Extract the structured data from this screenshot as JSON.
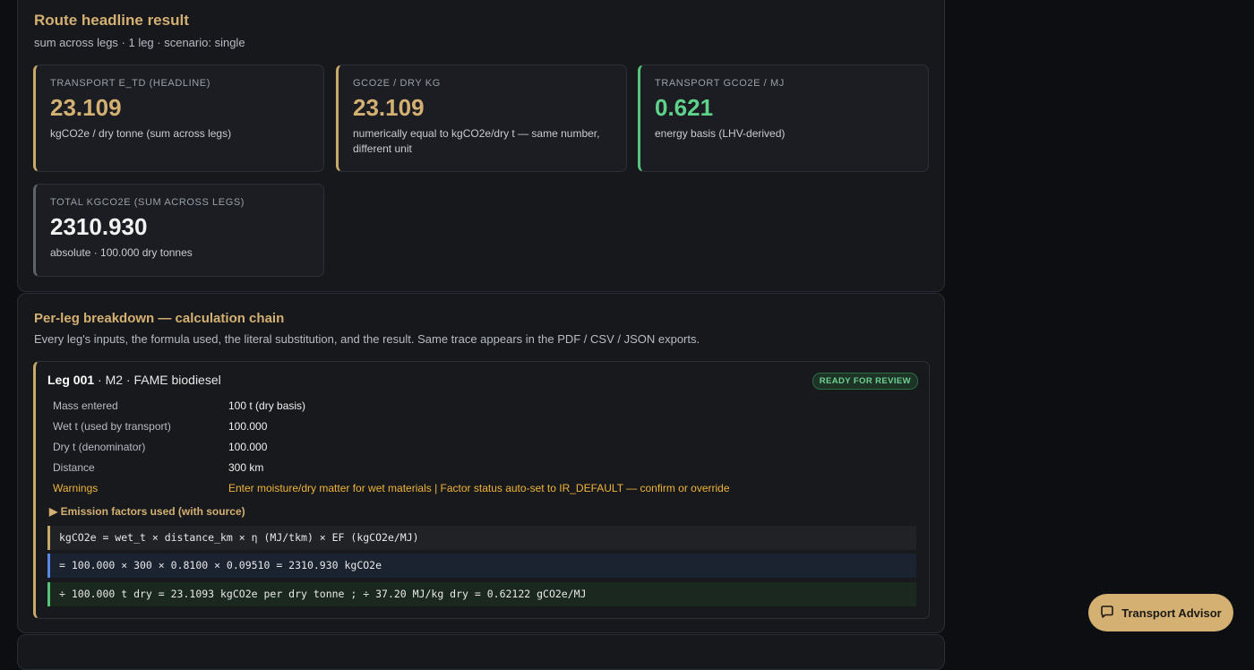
{
  "headline": {
    "title": "Route headline result",
    "subtitle": "sum across legs · 1 leg · scenario: single",
    "cards": [
      {
        "label": "TRANSPORT E_TD (HEADLINE)",
        "value": "23.109",
        "note": "kgCO2e / dry tonne (sum across legs)"
      },
      {
        "label": "GCO2E / DRY KG",
        "value": "23.109",
        "note": "numerically equal to kgCO2e/dry t — same number, different unit"
      },
      {
        "label": "TRANSPORT GCO2E / MJ",
        "value": "0.621",
        "note": "energy basis (LHV-derived)"
      },
      {
        "label": "TOTAL KGCO2E (SUM ACROSS LEGS)",
        "value": "2310.930",
        "note": "absolute · 100.000 dry tonnes"
      }
    ]
  },
  "breakdown": {
    "title": "Per-leg breakdown — calculation chain",
    "subtitle": "Every leg's inputs, the formula used, the literal substitution, and the result. Same trace appears in the PDF / CSV / JSON exports.",
    "leg": {
      "id": "Leg 001",
      "desc": "· M2 · FAME biodiesel",
      "badge": "READY FOR REVIEW",
      "rows": [
        {
          "k": "Mass entered",
          "v": "100 t (dry basis)"
        },
        {
          "k": "Wet t (used by transport)",
          "v": "100.000"
        },
        {
          "k": "Dry t (denominator)",
          "v": "100.000"
        },
        {
          "k": "Distance",
          "v": "300 km"
        },
        {
          "k": "Warnings",
          "v": "Enter moisture/dry matter for wet materials | Factor status auto-set to IR_DEFAULT — confirm or override"
        }
      ],
      "ef_toggle": "▶ Emission factors used (with source)",
      "formula": "kgCO2e = wet_t × distance_km × η (MJ/tkm) × EF (kgCO2e/MJ)",
      "substitution": "= 100.000 × 300 × 0.8100 × 0.09510 = 2310.930 kgCO2e",
      "result": "÷ 100.000 t dry = 23.1093 kgCO2e per dry tonne ; ÷ 37.20 MJ/kg dry = 0.62122 gCO2e/MJ"
    }
  },
  "advisor": {
    "label": "Transport Advisor",
    "icon": "chat-bubble-icon"
  },
  "colors": {
    "accent": "#d4b072",
    "positive": "#5fd389",
    "warning": "#f0b43a",
    "background": "#0d0e11"
  }
}
